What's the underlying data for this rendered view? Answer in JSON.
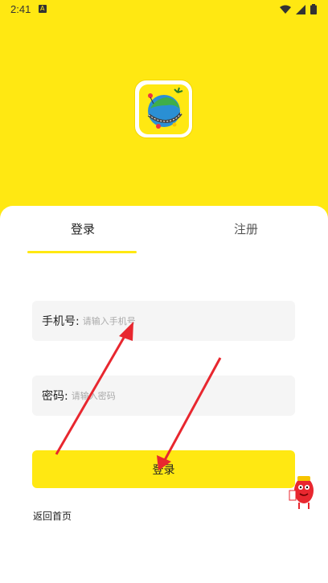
{
  "status_bar": {
    "time": "2:41",
    "notification_icon": "a-box-icon",
    "wifi_icon": "wifi-icon",
    "signal_icon": "signal-icon",
    "battery_icon": "battery-icon"
  },
  "app_logo": {
    "icon": "globe-map-logo-icon"
  },
  "tabs": [
    {
      "label": "登录",
      "active": true
    },
    {
      "label": "注册",
      "active": false
    }
  ],
  "form": {
    "phone": {
      "label": "手机号:",
      "placeholder": "请输入手机号"
    },
    "password": {
      "label": "密码:",
      "placeholder": "请输入密码"
    },
    "login_button": "登录",
    "back_link": "返回首页"
  },
  "colors": {
    "accent": "#ffe812",
    "arrow": "#e8272f",
    "field_bg": "#f5f5f5"
  }
}
